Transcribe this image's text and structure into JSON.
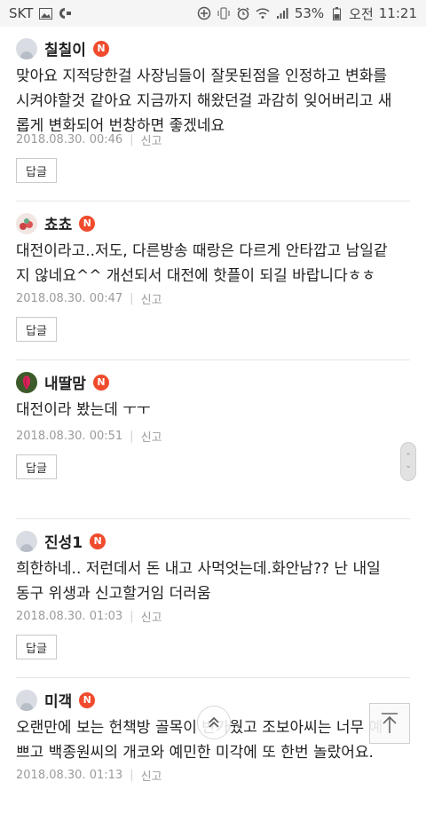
{
  "status_bar": {
    "carrier": "SKT",
    "battery": "53%",
    "ampm": "오전",
    "time": "11:21"
  },
  "comments": [
    {
      "username": "칠칠이",
      "badge": "N",
      "text_lines": [
        "맞아요 지적당한걸 사장님들이 잘못된점을 인정하고 변화를",
        "시켜야할것 같아요 지금까지 해왔던걸 과감히 잊어버리고 새",
        "롭게 변화되어 번창하면 좋겠네요"
      ],
      "date": "2018.08.30. 00:46",
      "report_label": "신고",
      "reply_label": "답글"
    },
    {
      "username": "쵸쵸",
      "badge": "N",
      "text_lines": [
        "대전이라고..저도, 다른방송 때랑은 다르게 안타깝고 남일같",
        "지 않네요^^ 개선되서 대전에 핫플이 되길 바랍니다ㅎㅎ"
      ],
      "date": "2018.08.30. 00:47",
      "report_label": "신고",
      "reply_label": "답글"
    },
    {
      "username": "내딸맘",
      "badge": "N",
      "text_lines": [
        "대전이라 봤는데 ㅜㅜ"
      ],
      "date": "2018.08.30. 00:51",
      "report_label": "신고",
      "reply_label": "답글"
    },
    {
      "username": "진성1",
      "badge": "N",
      "text_lines": [
        "희한하네.. 저런데서 돈 내고 사먹엇는데.화안남?? 난 내일",
        "동구 위생과 신고할거임 더러움"
      ],
      "date": "2018.08.30. 01:03",
      "report_label": "신고",
      "reply_label": "답글"
    },
    {
      "username": "미객",
      "badge": "N",
      "text_lines": [
        "오랜만에 보는 헌책방 골목이 반가웠고 조보아씨는 너무 예",
        "쁘고 백종원씨의 개코와 예민한 미각에 또 한번 놀랐어요."
      ],
      "date": "2018.08.30. 01:13",
      "report_label": "신고",
      "reply_label": "답글"
    }
  ]
}
